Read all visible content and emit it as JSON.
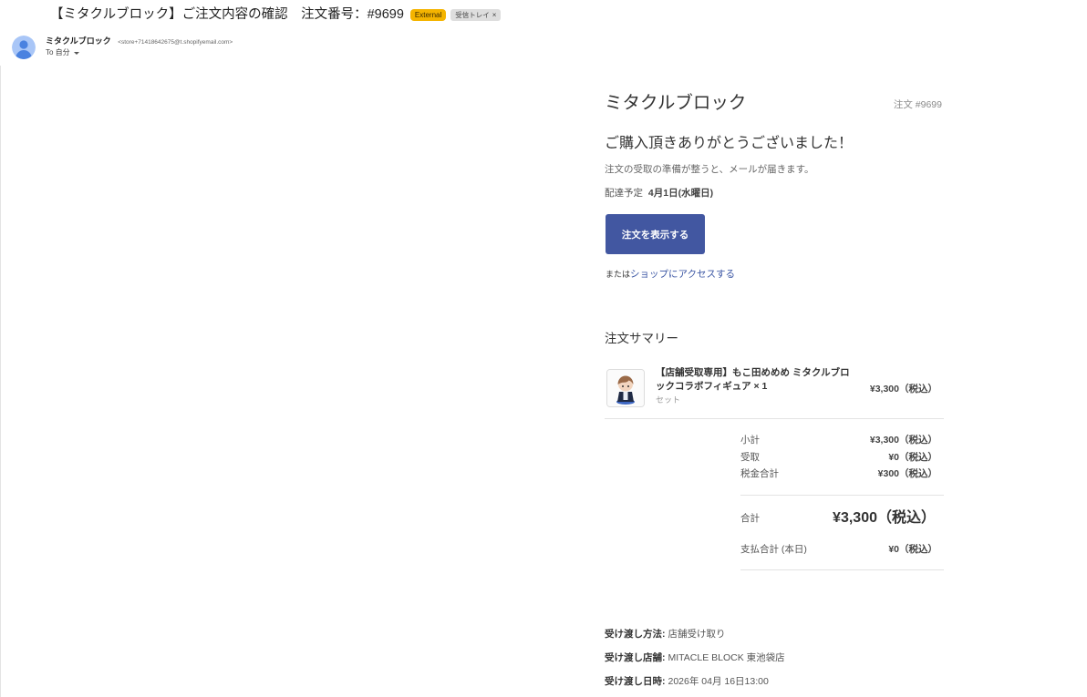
{
  "theme": {
    "button": "#4257a1",
    "link": "#3a55a3",
    "external_label": "#f4b400"
  },
  "email": {
    "subject": "【ミタクルブロック】ご注文内容の確認　注文番号：#9699",
    "labels": [
      {
        "text": "External"
      },
      {
        "text": "受信トレイ",
        "close": "×"
      }
    ],
    "sender": {
      "name": "ミタクルブロック",
      "address": "<store+71418642675@t.shopifyemail.com>",
      "to": "To 自分"
    }
  },
  "order": {
    "shop_name": "ミタクルブロック",
    "order_number": "注文 #9699",
    "heading": "ご購入頂きありがとうございました！",
    "notice": "注文の受取の準備が整うと、メールが届きます。",
    "delivery_label": "配達予定",
    "delivery_date": "4月1日(水曜日)",
    "view_order_button": "注文を表示する",
    "or_text": "または",
    "shop_link": "ショップにアクセスする",
    "summary_title": "注文サマリー",
    "items": [
      {
        "title": "【店舗受取専用】もこ田めめめ ミタクルブロックコラボフィギュア × 1",
        "variant": "セット",
        "price": "¥3,300（税込）"
      }
    ],
    "totals": {
      "subtotal": {
        "label": "小計",
        "value": "¥3,300（税込）"
      },
      "pickup_fee": {
        "label": "受取",
        "value": "¥0（税込）"
      },
      "tax": {
        "label": "税金合計",
        "value": "¥300（税込）"
      },
      "total": {
        "label": "合計",
        "value": "¥3,300（税込）"
      },
      "paid_today": {
        "label": "支払合計 (本日)",
        "value": "¥0（税込）"
      }
    },
    "pickup": [
      {
        "label": "受け渡し方法:",
        "value": "店舗受け取り"
      },
      {
        "label": "受け渡し店舗:",
        "value": "MITACLE BLOCK 東池袋店"
      },
      {
        "label": "受け渡し日時:",
        "value": "2026年 04月 16日13:00"
      }
    ]
  }
}
